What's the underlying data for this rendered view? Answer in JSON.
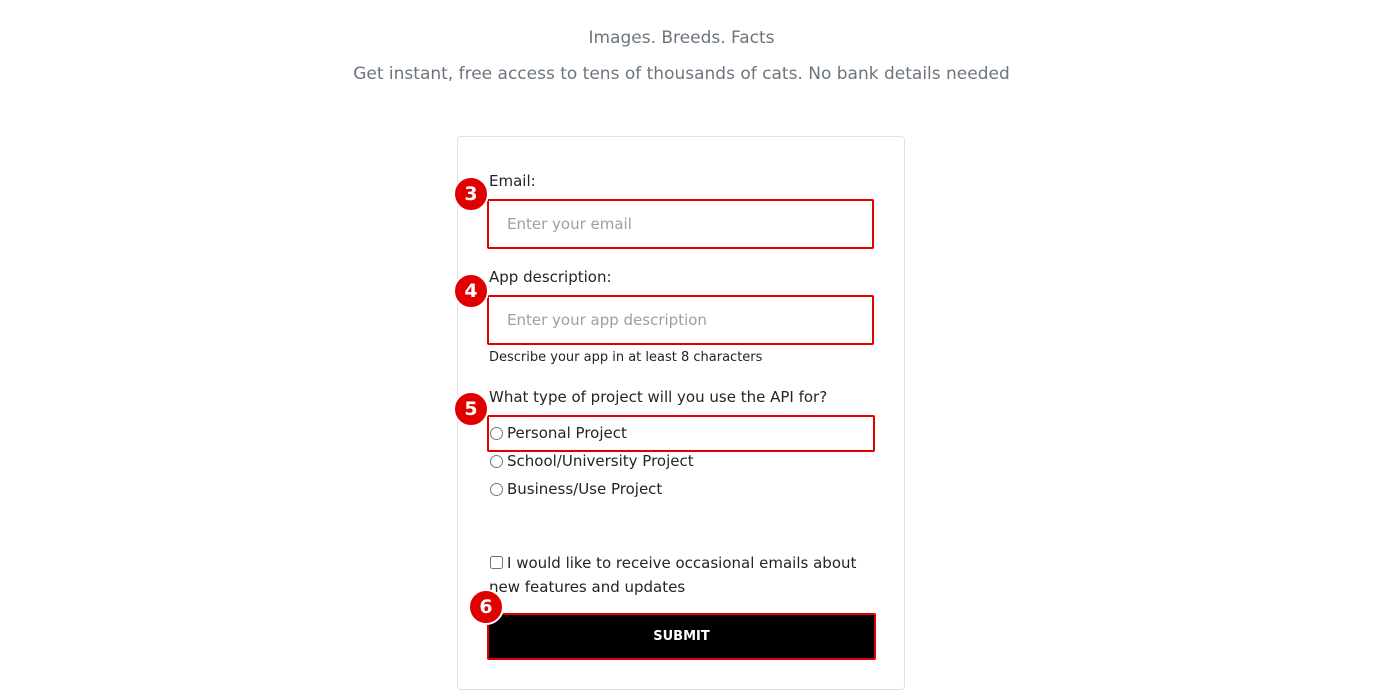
{
  "header": {
    "tagline": "Images. Breeds. Facts",
    "subtitle": "Get instant, free access to tens of thousands of cats. No bank details needed"
  },
  "form": {
    "email": {
      "label": "Email:",
      "placeholder": "Enter your email",
      "value": ""
    },
    "description": {
      "label": "App description:",
      "placeholder": "Enter your app description",
      "value": "",
      "help": "Describe your app in at least 8 characters"
    },
    "project_type": {
      "question": "What type of project will you use the API for?",
      "options": [
        {
          "label": "Personal Project",
          "checked": false
        },
        {
          "label": "School/University Project",
          "checked": false
        },
        {
          "label": "Business/Use Project",
          "checked": false
        }
      ]
    },
    "newsletter": {
      "label": "I would like to receive occasional emails about new features and updates",
      "checked": false
    },
    "submit_label": "SUBMIT"
  },
  "annotations": {
    "badge_color": "#e00000",
    "markers": [
      "3",
      "4",
      "5",
      "6"
    ]
  }
}
